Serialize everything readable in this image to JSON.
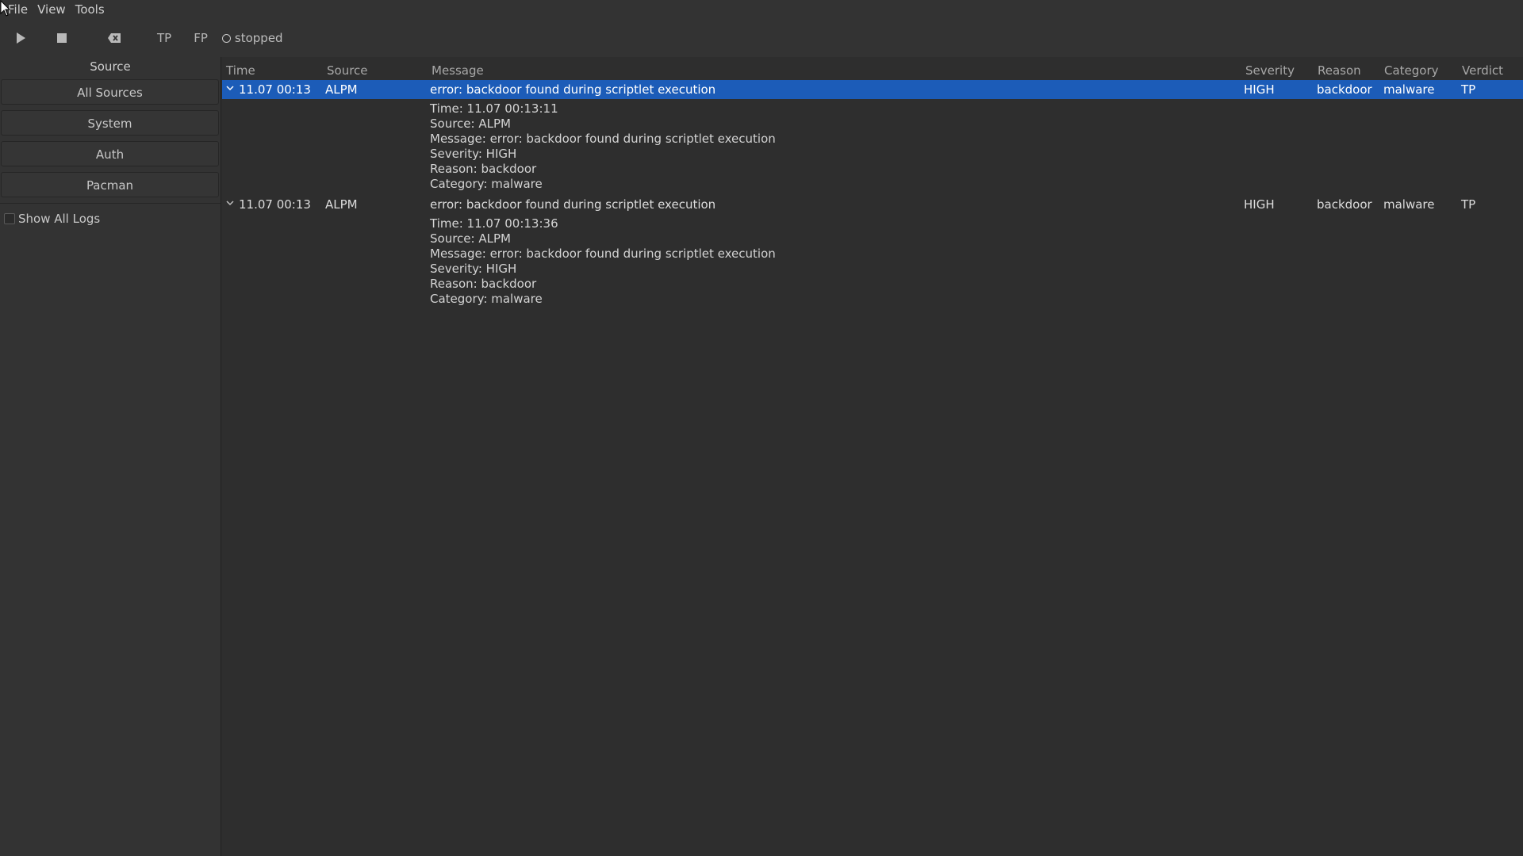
{
  "menu": {
    "file": "File",
    "view": "View",
    "tools": "Tools"
  },
  "toolbar": {
    "play_icon": "play-icon",
    "stop_icon": "stop-icon",
    "clear_icon": "clear-backspace-icon",
    "tp_label": "TP",
    "fp_label": "FP",
    "status_text": "stopped"
  },
  "sidebar": {
    "title": "Source",
    "sources": [
      "All Sources",
      "System",
      "Auth",
      "Pacman"
    ],
    "show_all_label": "Show All Logs",
    "show_all_checked": false
  },
  "table": {
    "headers": {
      "time": "Time",
      "source": "Source",
      "message": "Message",
      "severity": "Severity",
      "reason": "Reason",
      "category": "Category",
      "verdict": "Verdict"
    },
    "rows": [
      {
        "time": "11.07 00:13",
        "source": "ALPM",
        "message": "error: backdoor found during scriptlet execution",
        "severity": "HIGH",
        "reason": "backdoor",
        "category": "malware",
        "verdict": "TP",
        "selected": true,
        "details": [
          "Time: 11.07 00:13:11",
          "Source: ALPM",
          "Message: error: backdoor found during scriptlet execution",
          "Severity: HIGH",
          "Reason: backdoor",
          "Category: malware"
        ]
      },
      {
        "time": "11.07 00:13",
        "source": "ALPM",
        "message": "error: backdoor found during scriptlet execution",
        "severity": "HIGH",
        "reason": "backdoor",
        "category": "malware",
        "verdict": "TP",
        "selected": false,
        "details": [
          "Time: 11.07 00:13:36",
          "Source: ALPM",
          "Message: error: backdoor found during scriptlet execution",
          "Severity: HIGH",
          "Reason: backdoor",
          "Category: malware"
        ]
      }
    ]
  },
  "colors": {
    "selection": "#1c5cb8",
    "background": "#2e2e2e",
    "panel": "#333333"
  }
}
